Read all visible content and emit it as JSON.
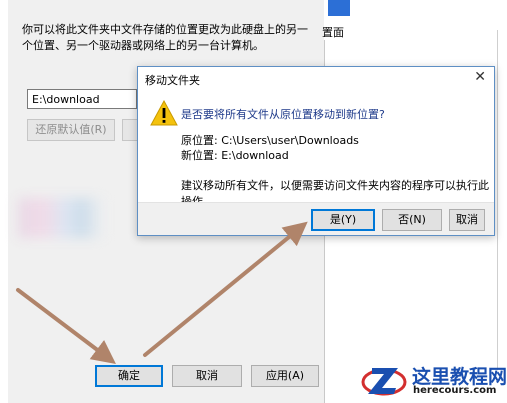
{
  "background_window": {
    "description": "你可以将此文件夹中文件存储的位置更改为此硬盘上的另一个位置、另一个驱动器或网络上的另一台计算机。",
    "path_value": "E:\\download",
    "restore_default_label": "还原默认值(R)",
    "ok_label": "确定",
    "cancel_label": "取消",
    "apply_label": "应用(A)",
    "tab_fragment": "置面"
  },
  "dialog": {
    "title": "移动文件夹",
    "question": "是否要将所有文件从原位置移动到新位置?",
    "original_location": "原位置: C:\\Users\\user\\Downloads",
    "new_location": "新位置: E:\\download",
    "advice": "建议移动所有文件，以便需要访问文件夹内容的程序可以执行此操作。",
    "yes_label": "是(Y)",
    "no_label": "否(N)",
    "cancel_label": "取消"
  },
  "watermark": {
    "site_name": "这里教程网",
    "url": "herecours.com"
  },
  "colors": {
    "accent": "#0078d7",
    "arrow": "#b0846a",
    "warning": "#f4c20d",
    "watermark_blue": "#1a4fb0",
    "watermark_red": "#d32f2f"
  },
  "icons": {
    "close": "close-icon",
    "warning": "warning-icon"
  }
}
